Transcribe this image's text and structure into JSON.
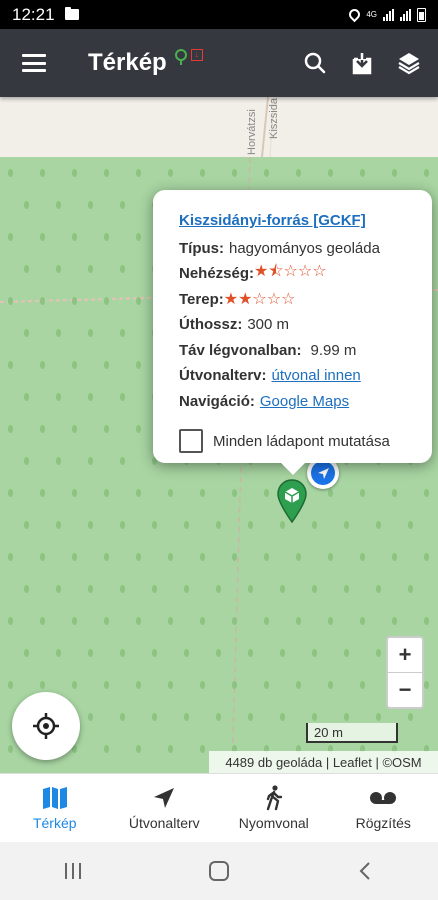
{
  "status_bar": {
    "time": "12:21",
    "network": "4G"
  },
  "app_bar": {
    "title": "Térkép",
    "badge_red": "↓"
  },
  "popup": {
    "title": "Kiszsidányi-forrás [GCKF]",
    "type_label": "Típus:",
    "type_value": "hagyományos geoláda",
    "difficulty_label": "Nehézség:",
    "difficulty_stars": "★⯪☆☆☆",
    "difficulty_value": 1.5,
    "terrain_label": "Terep:",
    "terrain_stars": "★★☆☆☆",
    "terrain_value": 2,
    "length_label": "Úthossz:",
    "length_value": "300 m",
    "distance_label": "Táv légvonalban:",
    "distance_value": "9.99 m",
    "route_label": "Útvonalterv:",
    "route_link": "útvonal innen",
    "nav_label": "Navigáció:",
    "nav_link": "Google Maps",
    "show_all_checkbox": "Minden ládapont mutatása",
    "show_all_checked": false
  },
  "map": {
    "road_label_1": "Horvátzsi",
    "road_label_2": "Kiszsida",
    "zoom_in": "+",
    "zoom_out": "−",
    "scale": "20 m",
    "attribution": "4489 db geoláda | Leaflet | ©OSM"
  },
  "bottom_nav": [
    {
      "label": "Térkép",
      "icon": "map-icon",
      "active": true
    },
    {
      "label": "Útvonalterv",
      "icon": "navigation-arrow-icon",
      "active": false
    },
    {
      "label": "Nyomvonal",
      "icon": "walking-person-icon",
      "active": false
    },
    {
      "label": "Rögzítés",
      "icon": "record-icon",
      "active": false
    }
  ],
  "colors": {
    "app_bar": "#35383f",
    "accent": "#1e88e5",
    "link": "#1e6fbe",
    "stars": "#e0512a",
    "forest": "#a8d5a2",
    "marker": "#2e9e4f"
  }
}
